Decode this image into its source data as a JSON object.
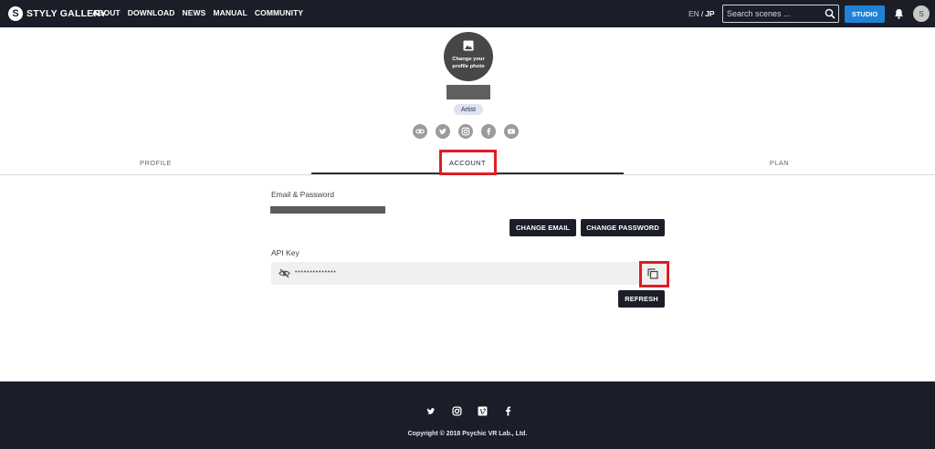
{
  "header": {
    "logo_mark": "S",
    "logo_text": "STYLY GALLERY",
    "nav": [
      "ABOUT",
      "DOWNLOAD",
      "NEWS",
      "MANUAL",
      "COMMUNITY"
    ],
    "lang_en": "EN",
    "lang_sep": "/",
    "lang_jp": "JP",
    "search_placeholder": "Search scenes ...",
    "studio_label": "STUDIO",
    "avatar_initial": "S"
  },
  "profile": {
    "change_photo_line1": "Change your",
    "change_photo_line2": "profile photo",
    "role": "Artist",
    "socials": [
      "link-icon",
      "twitter-icon",
      "instagram-icon",
      "facebook-icon",
      "youtube-icon"
    ]
  },
  "tabs": [
    {
      "label": "PROFILE",
      "active": false
    },
    {
      "label": "ACCOUNT",
      "active": true
    },
    {
      "label": "PLAN",
      "active": false
    }
  ],
  "account": {
    "email_password_label": "Email & Password",
    "change_email_label": "CHANGE EMAIL",
    "change_password_label": "CHANGE PASSWORD",
    "api_key_label": "API Key",
    "api_key_masked": "••••••••••••••",
    "refresh_label": "REFRESH"
  },
  "footer": {
    "socials": [
      "twitter-icon",
      "instagram-icon",
      "vimeo-icon",
      "facebook-icon"
    ],
    "copyright": "Copyright © 2018 Psychic VR Lab., Ltd."
  },
  "colors": {
    "header_bg": "#1b1e29",
    "accent_blue": "#1f82d6",
    "highlight_red": "#e01b24"
  }
}
